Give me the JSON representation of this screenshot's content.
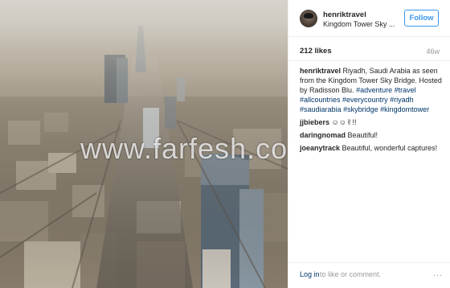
{
  "post": {
    "username": "henriktravel",
    "location": "Kingdom Tower Sky ...",
    "follow_label": "Follow",
    "likes": "212 likes",
    "age": "46w",
    "caption": {
      "user": "henriktravel",
      "text": "Riyadh, Saudi Arabia as seen from the Kingdom Tower Sky Bridge. Hosted by Radisson Blu.",
      "hashtags": [
        "#adventure",
        "#travel",
        "#allcountries",
        "#everycountry",
        "#riyadh",
        "#saudiarabia",
        "#skybridge",
        "#kingdomtower"
      ]
    },
    "comments": [
      {
        "user": "jjbiebers",
        "text": "☺☺✌!!"
      },
      {
        "user": "daringnomad",
        "text": "Beautiful!"
      },
      {
        "user": "joeanytrack",
        "text": "Beautiful, wonderful captures!"
      }
    ]
  },
  "footer": {
    "login_label": "Log in",
    "login_suffix": "to like or comment.",
    "more_icon": "..."
  },
  "watermark": "www.farfesh.com",
  "colors": {
    "accent": "#3897f0",
    "hashtag": "#003569",
    "muted": "#999999"
  }
}
